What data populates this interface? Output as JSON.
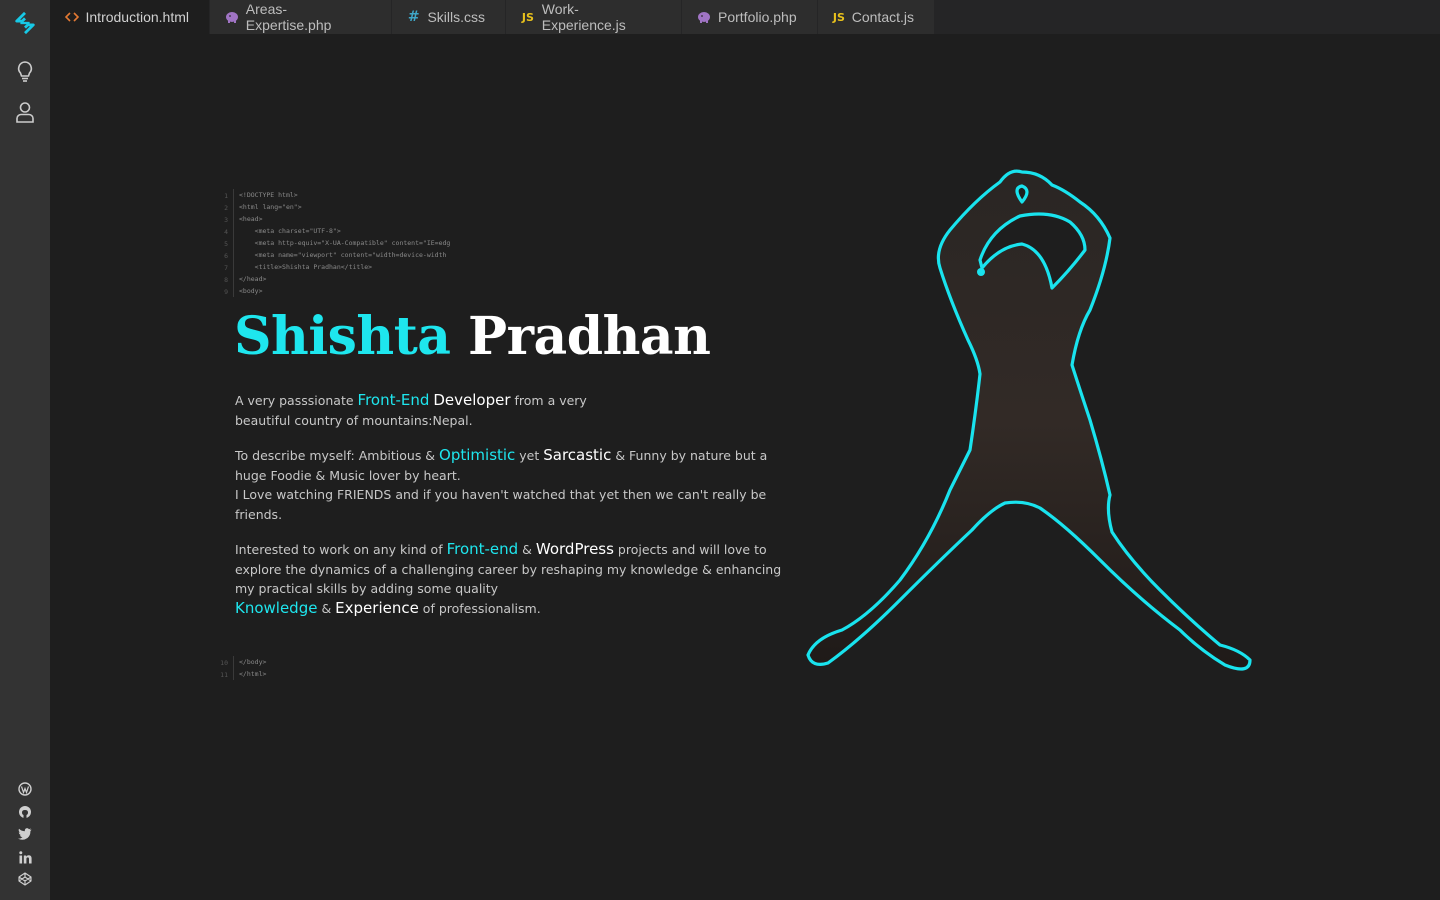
{
  "tabs": [
    {
      "label": "Introduction.html",
      "icon": "code-icon",
      "active": true
    },
    {
      "label": "Areas-Expertise.php",
      "icon": "php-icon"
    },
    {
      "label": "Skills.css",
      "icon": "hash-icon"
    },
    {
      "label": "Work-Experience.js",
      "icon": "js-icon"
    },
    {
      "label": "Portfolio.php",
      "icon": "php-icon"
    },
    {
      "label": "Contact.js",
      "icon": "js-icon"
    }
  ],
  "tab_icon_text": {
    "js": "JS",
    "hash": "#",
    "code": "<>"
  },
  "sidebar": {
    "top_icons": [
      "logo-icon",
      "lightbulb-icon",
      "user-icon"
    ],
    "social_icons": [
      "wordpress-icon",
      "github-icon",
      "twitter-icon",
      "linkedin-icon",
      "codepen-icon"
    ]
  },
  "code_head": {
    "line_numbers": [
      "1",
      "2",
      "3",
      "4",
      "5",
      "6",
      "7",
      "8",
      "9"
    ],
    "lines": [
      "<!DOCTYPE html>",
      "<html lang=\"en\">",
      "<head>",
      "    <meta charset=\"UTF-8\">",
      "    <meta http-equiv=\"X-UA-Compatible\" content=\"IE=edg",
      "    <meta name=\"viewport\" content=\"width=device-width",
      "    <title>Shishta Pradhan</title>",
      "</head>",
      "<body>"
    ]
  },
  "code_foot": {
    "line_numbers": [
      "10",
      "11"
    ],
    "lines": [
      "</body>",
      "</html>"
    ]
  },
  "hero": {
    "first_name": "Shishta",
    "last_name": "Pradhan"
  },
  "bio": {
    "p1": {
      "a": "A very passsionate ",
      "h1": "Front-End",
      "h2": "Developer",
      "b": " from a very beautiful country of mountains:Nepal."
    },
    "p2": {
      "a": "To describe myself: Ambitious & ",
      "h1": "Optimistic",
      "b": " yet ",
      "h2": "Sarcastic",
      "c": " & Funny by nature but a huge Foodie & Music lover by heart.",
      "d": "I Love watching FRIENDS and if you haven't watched that yet then we can't really be friends."
    },
    "p3": {
      "a": "Interested to work on any kind of ",
      "h1": "Front-end",
      "b": " & ",
      "h2": "WordPress",
      "c": " projects and will love to explore the dynamics of a challenging career by reshaping my knowledge & enhancing my practical skills by adding some quality ",
      "h3": "Knowledge",
      "d": " & ",
      "h4": "Experience",
      "e": " of professionalism."
    }
  },
  "colors": {
    "accent": "#1ee6ee",
    "background": "#1e1e1e",
    "sidebar": "#333333",
    "tabbar": "#252526"
  }
}
